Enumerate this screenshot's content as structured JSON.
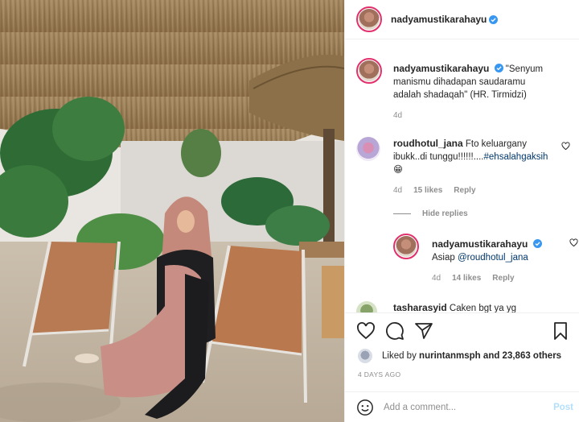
{
  "post": {
    "username": "nadyamustikarahayu",
    "verified": true
  },
  "caption": {
    "username": "nadyamustikarahayu",
    "text": "\"Senyum manismu dihadapan saudaramu adalah shadaqah\" (HR. Tirmidzi)",
    "age": "4d"
  },
  "comments": [
    {
      "username": "roudhotul_jana",
      "text_before": "Fto keluargany ibukk..di tunggu!!!!!!....",
      "hashtag": "#ehsalahgaksih",
      "emoji": "😁",
      "age": "4d",
      "likes": "15 likes",
      "reply_label": "Reply"
    }
  ],
  "hide_replies_label": "Hide replies",
  "reply": {
    "username": "nadyamustikarahayu",
    "text": "Asiap",
    "mention": "@roudhotul_jana",
    "age": "4d",
    "likes": "14 likes",
    "reply_label": "Reply"
  },
  "next_comment": {
    "username": "tasharasyid",
    "text": "Caken bgt ya yg"
  },
  "liked_by": {
    "prefix": "Liked by",
    "user": "nurintanmsph",
    "suffix": "and 23,863 others"
  },
  "timestamp": "4 DAYS AGO",
  "add_comment": {
    "placeholder": "Add a comment...",
    "post_label": "Post"
  },
  "colors": {
    "verified_blue": "#3897f0",
    "muted": "#8e8e8e",
    "post_disabled": "#b2dffc",
    "link": "#00376b"
  },
  "icons": [
    "heart-icon",
    "comment-icon",
    "share-icon",
    "bookmark-icon",
    "emoji-icon",
    "verified-icon"
  ]
}
